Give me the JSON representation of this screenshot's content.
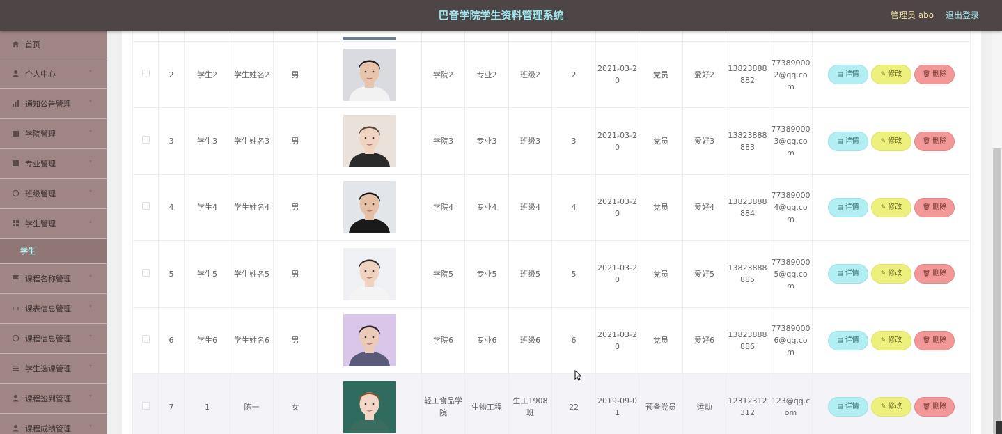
{
  "header": {
    "title": "巴音学院学生资料管理系统",
    "admin_label": "管理员 abo",
    "logout_label": "退出登录"
  },
  "sidebar": {
    "items": [
      {
        "label": "首页",
        "icon": "home-icon"
      },
      {
        "label": "个人中心",
        "icon": "user-icon"
      },
      {
        "label": "通知公告管理",
        "icon": "chart-icon"
      },
      {
        "label": "学院管理",
        "icon": "building-icon"
      },
      {
        "label": "专业管理",
        "icon": "grid-icon"
      },
      {
        "label": "班级管理",
        "icon": "circle-icon"
      },
      {
        "label": "学生管理",
        "icon": "apps-icon"
      }
    ],
    "active_sub": "学生",
    "items_after": [
      {
        "label": "课程名称管理",
        "icon": "flag-icon"
      },
      {
        "label": "课表信息管理",
        "icon": "refresh-icon"
      },
      {
        "label": "课程信息管理",
        "icon": "circle-icon"
      },
      {
        "label": "学生选课管理",
        "icon": "list-icon"
      },
      {
        "label": "课程签到管理",
        "icon": "user-icon"
      },
      {
        "label": "课程成绩管理",
        "icon": "user-icon"
      }
    ]
  },
  "actions": {
    "detail": "详情",
    "edit": "修改",
    "delete": "删除"
  },
  "rows": [
    {
      "id": "2",
      "student_no": "学生2",
      "name": "学生姓名2",
      "gender": "男",
      "college": "学院2",
      "major": "专业2",
      "class": "班级2",
      "age": "2",
      "date": "2021-03-20",
      "political": "党员",
      "hobby": "爱好2",
      "phone": "13823888882",
      "email": "773890002@qq.com"
    },
    {
      "id": "3",
      "student_no": "学生3",
      "name": "学生姓名3",
      "gender": "男",
      "college": "学院3",
      "major": "专业3",
      "class": "班级3",
      "age": "3",
      "date": "2021-03-20",
      "political": "党员",
      "hobby": "爱好3",
      "phone": "13823888883",
      "email": "773890003@qq.com"
    },
    {
      "id": "4",
      "student_no": "学生4",
      "name": "学生姓名4",
      "gender": "男",
      "college": "学院4",
      "major": "专业4",
      "class": "班级4",
      "age": "4",
      "date": "2021-03-20",
      "political": "党员",
      "hobby": "爱好4",
      "phone": "13823888884",
      "email": "773890004@qq.com"
    },
    {
      "id": "5",
      "student_no": "学生5",
      "name": "学生姓名5",
      "gender": "男",
      "college": "学院5",
      "major": "专业5",
      "class": "班级5",
      "age": "5",
      "date": "2021-03-20",
      "political": "党员",
      "hobby": "爱好5",
      "phone": "13823888885",
      "email": "773890005@qq.com"
    },
    {
      "id": "6",
      "student_no": "学生6",
      "name": "学生姓名6",
      "gender": "男",
      "college": "学院6",
      "major": "专业6",
      "class": "班级6",
      "age": "6",
      "date": "2021-03-20",
      "political": "党员",
      "hobby": "爱好6",
      "phone": "13823888886",
      "email": "773890006@qq.com"
    },
    {
      "id": "7",
      "student_no": "1",
      "name": "陈一",
      "gender": "女",
      "college": "轻工食品学院",
      "major": "生物工程",
      "class": "生工1908班",
      "age": "22",
      "date": "2019-09-01",
      "political": "预备党员",
      "hobby": "运动",
      "phone": "12312312312",
      "email": "123@qq.com"
    }
  ],
  "colors": {
    "topbar": "#4d4546",
    "sidebar": "#a08585",
    "title": "#9ee8f0",
    "detail_btn": "#b3eef2",
    "edit_btn": "#eef07e",
    "delete_btn": "#f39898"
  }
}
